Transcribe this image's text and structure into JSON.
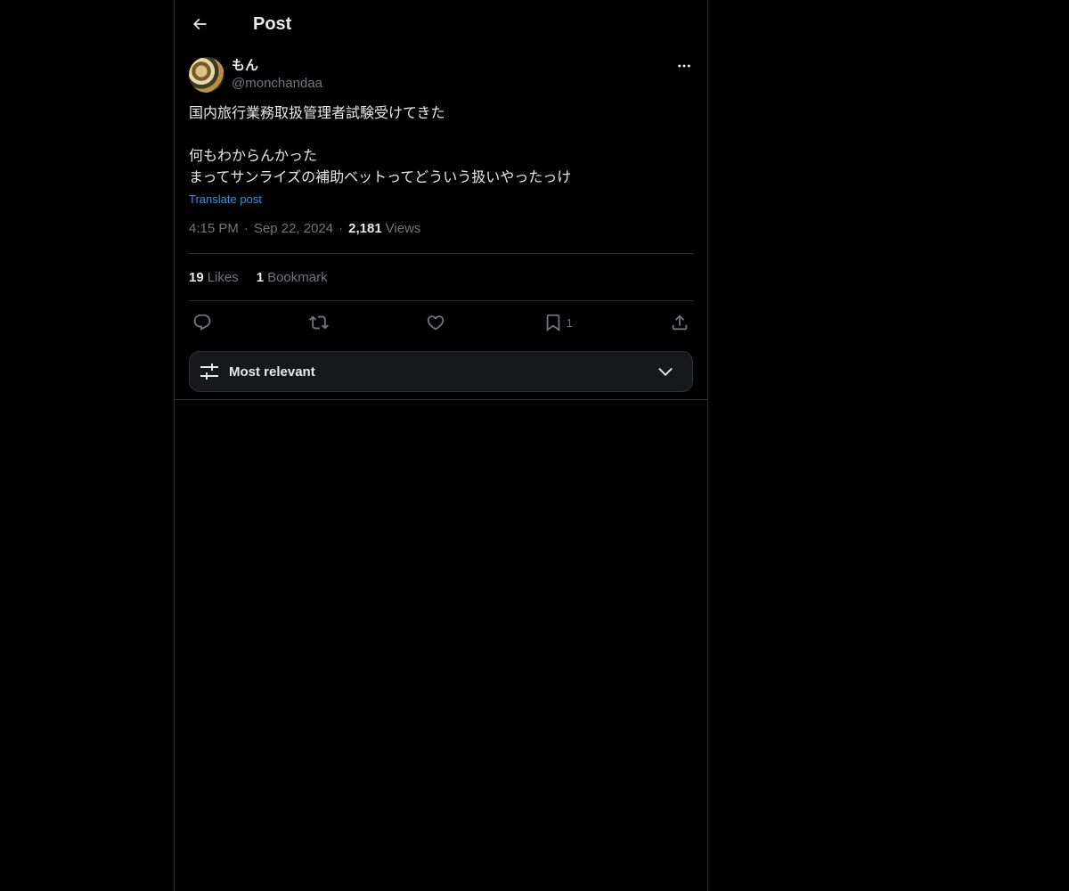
{
  "header": {
    "title": "Post",
    "back_icon": "arrow-left-icon"
  },
  "post": {
    "author": {
      "display_name": "もん",
      "handle": "@monchandaa"
    },
    "text": "国内旅行業務取扱管理者試験受けてきた\n\n何もわからんかった\nまってサンライズの補助ベットってどういう扱いやったっけ",
    "translate_label": "Translate post",
    "time": "4:15 PM",
    "date": "Sep 22, 2024",
    "views_count": "2,181",
    "views_label": "Views",
    "stats": {
      "likes_count": "19",
      "likes_label": "Likes",
      "bookmarks_count": "1",
      "bookmarks_label": "Bookmark"
    },
    "actions": {
      "reply_icon": "reply-icon",
      "repost_icon": "repost-icon",
      "like_icon": "heart-icon",
      "bookmark_icon": "bookmark-icon",
      "bookmark_count": "1",
      "share_icon": "share-icon"
    }
  },
  "sort": {
    "label": "Most relevant",
    "icon": "sliders-icon",
    "chevron": "chevron-down-icon"
  },
  "colors": {
    "background": "#000000",
    "text": "#e7e9ea",
    "secondary": "#71767b",
    "link": "#1d9bf0",
    "border": "#2f3336"
  }
}
